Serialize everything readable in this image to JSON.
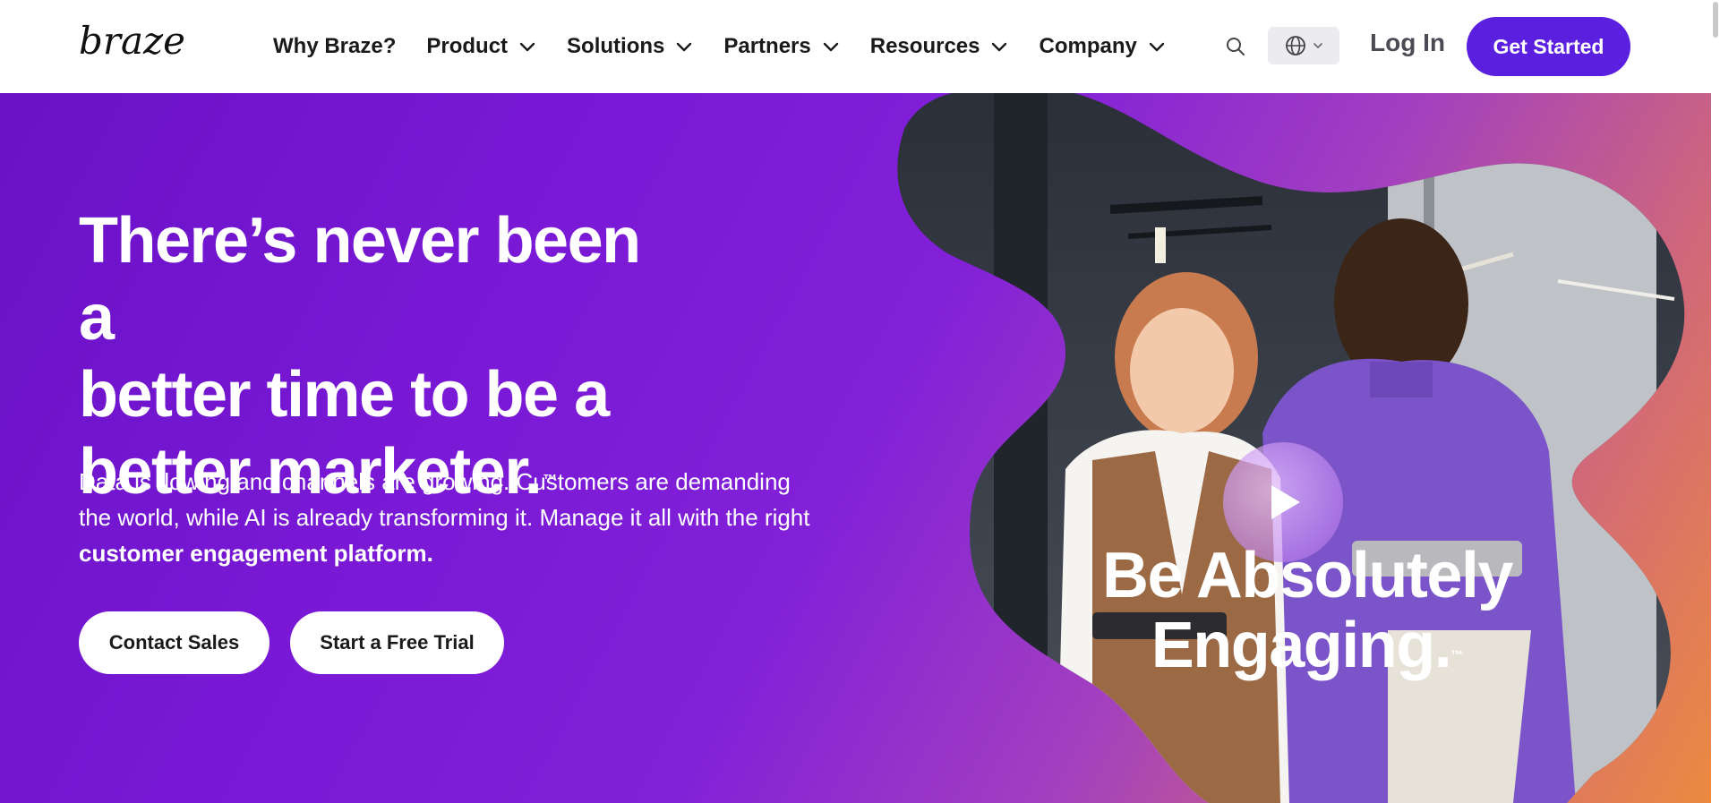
{
  "brand": {
    "logo_text": "braze",
    "primary_color": "#5b1fe0"
  },
  "nav": {
    "items": [
      {
        "label": "Why Braze?",
        "has_dropdown": false
      },
      {
        "label": "Product",
        "has_dropdown": true
      },
      {
        "label": "Solutions",
        "has_dropdown": true
      },
      {
        "label": "Partners",
        "has_dropdown": true
      },
      {
        "label": "Resources",
        "has_dropdown": true
      },
      {
        "label": "Company",
        "has_dropdown": true
      }
    ],
    "search_icon": "search-icon",
    "language_icon": "globe-icon",
    "login_label": "Log In",
    "cta_label": "Get Started"
  },
  "hero": {
    "headline": [
      "There’s never been a",
      "better time to be a",
      "better marketer."
    ],
    "headline_tm": "™",
    "subtext": "Data is flowing and channels are growing. Customers are demanding the world, while AI is already transforming it. Manage it all with the right ",
    "subtext_bold": "customer engagement platform.",
    "buttons": {
      "contact_sales": "Contact Sales",
      "free_trial": "Start a Free Trial"
    },
    "video": {
      "play_icon": "play-icon",
      "overlay_line1": "Be Absolutely",
      "overlay_line2": "Engaging.",
      "overlay_tm": "™"
    },
    "gradient_colors": [
      "#6a12c7",
      "#8220d8",
      "#d0687a",
      "#ec8a40"
    ]
  }
}
